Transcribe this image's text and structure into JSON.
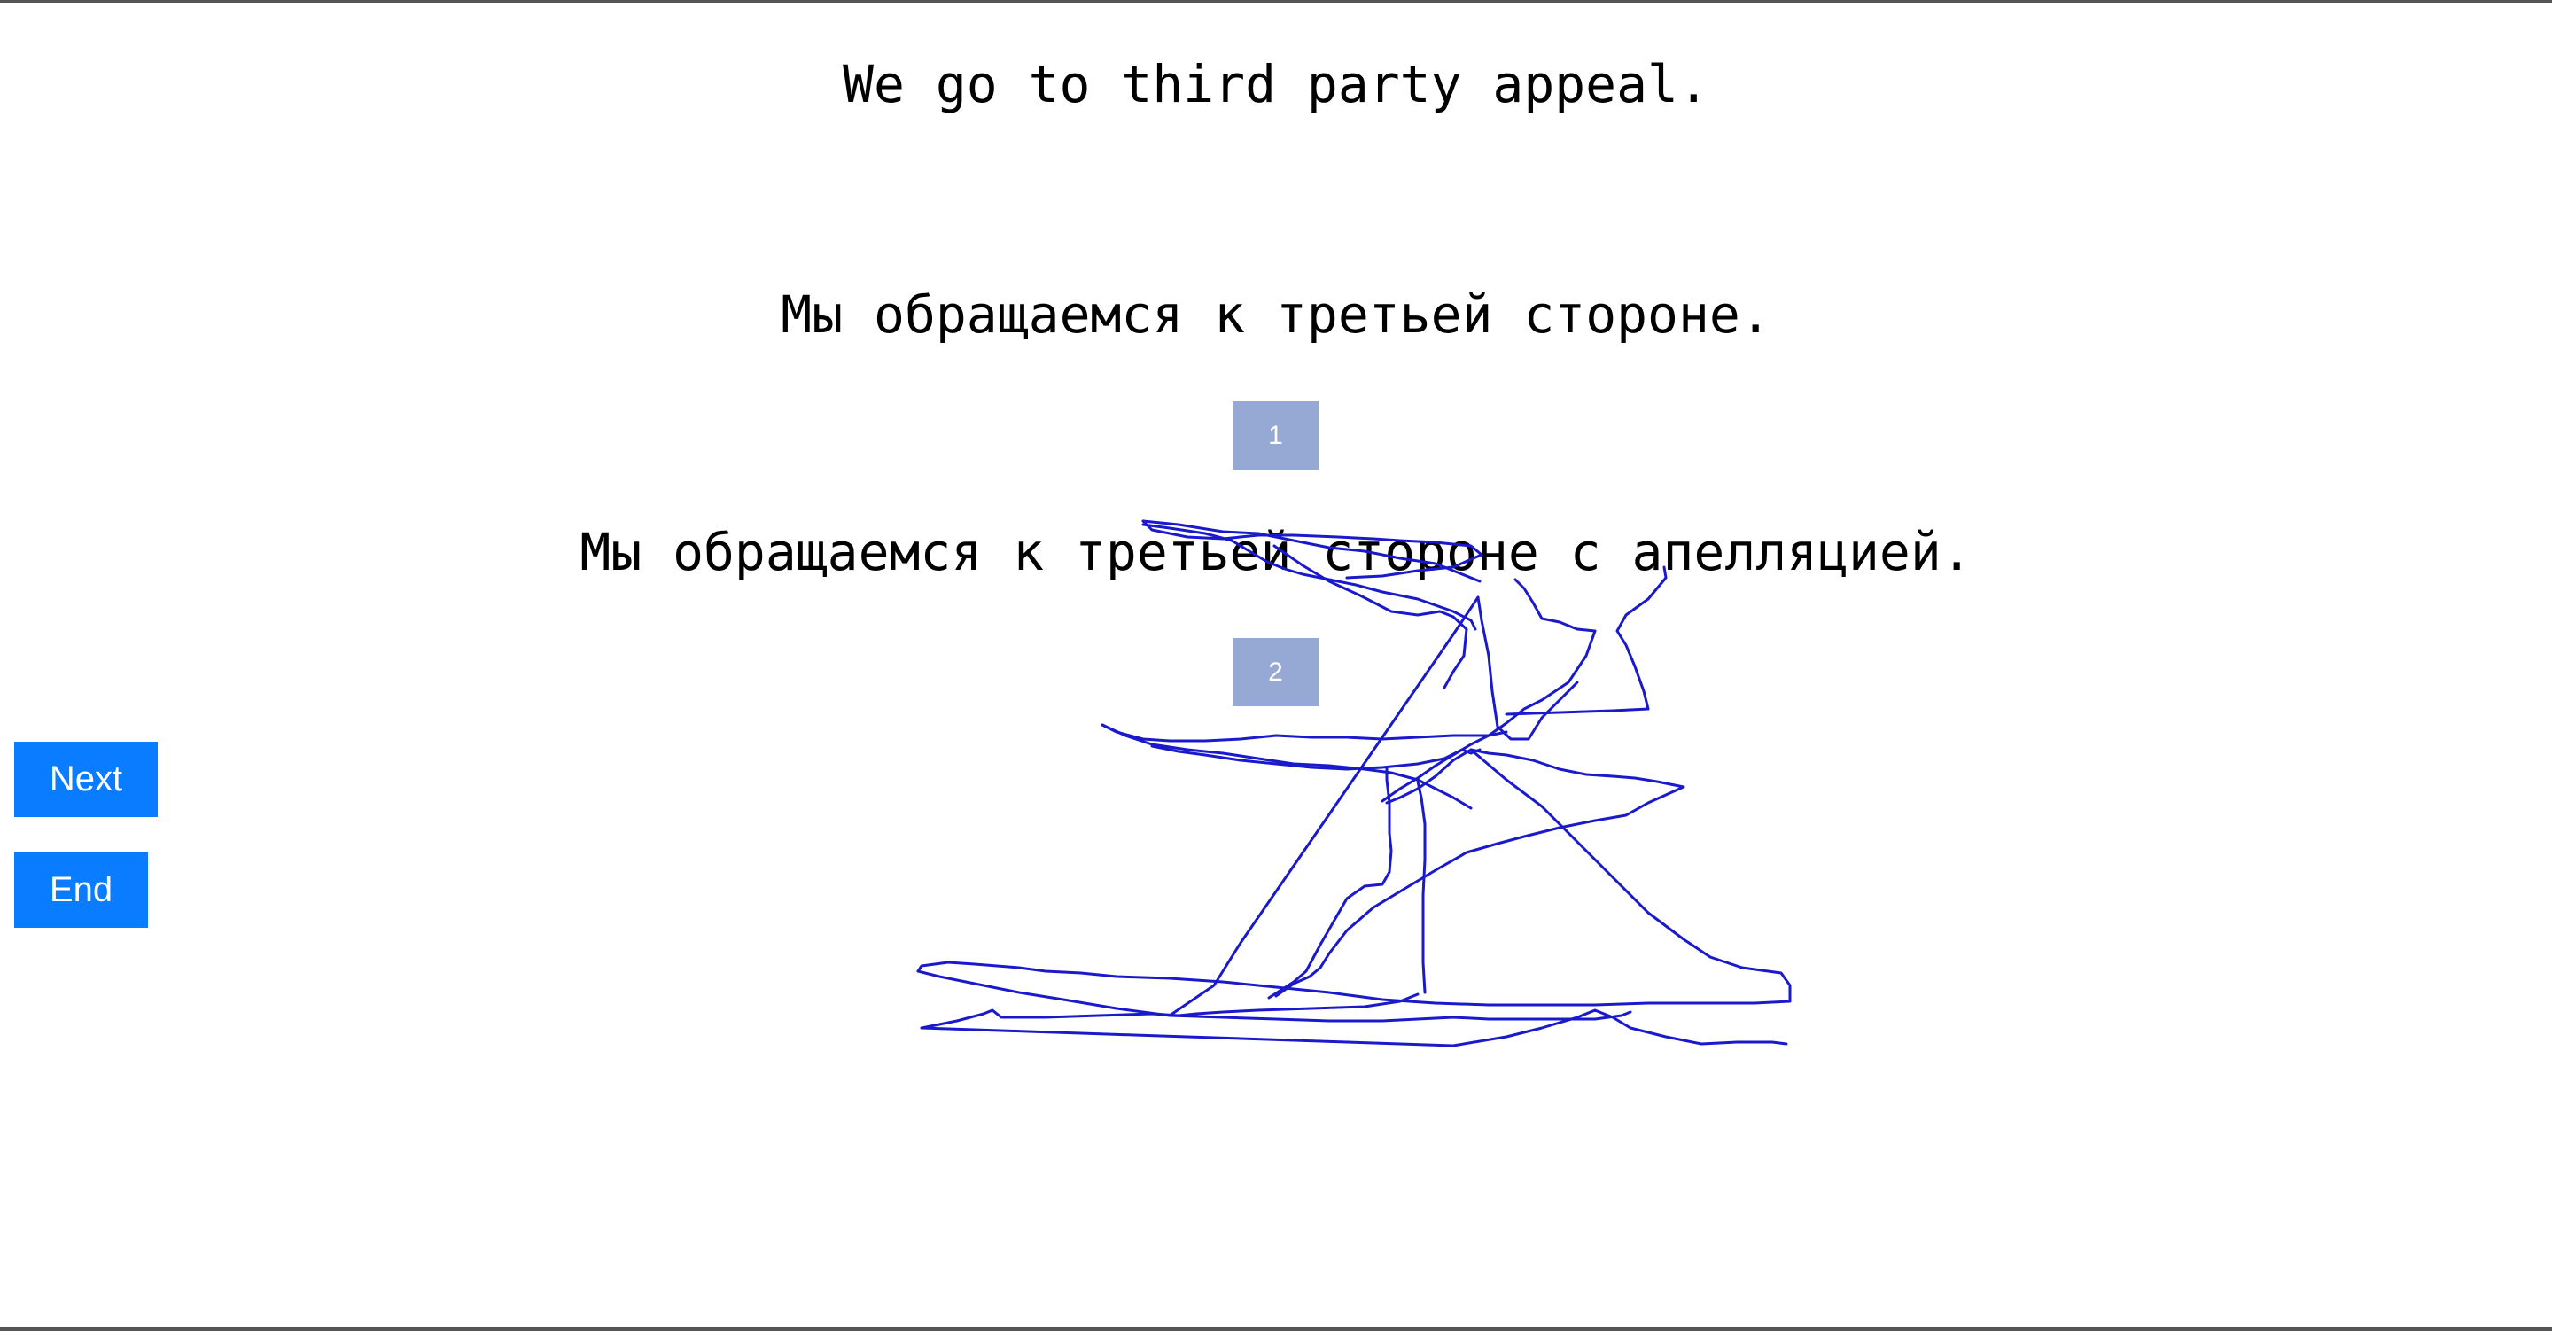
{
  "prompt": {
    "source_sentence": "We go to third party appeal."
  },
  "options": [
    {
      "number": "1",
      "text": "Мы обращаемся к третьей стороне."
    },
    {
      "number": "2",
      "text": "Мы обращаемся к третьей стороне с апелляцией."
    }
  ],
  "controls": {
    "next_label": "Next",
    "end_label": "End"
  },
  "colors": {
    "nav_button": "#0a7cff",
    "choice_button": "#96a8d4",
    "scribble_stroke": "#1a1acc"
  }
}
